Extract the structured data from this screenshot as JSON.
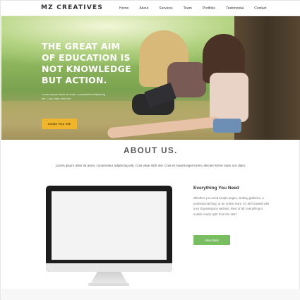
{
  "header": {
    "logo": "MZ CREATIVES",
    "nav": [
      "Home",
      "About",
      "Services",
      "Team",
      "Portfolio",
      "Testimonial",
      "Contact"
    ]
  },
  "hero": {
    "title": "THE GREAT AIM OF EDUCATION IS NOT KNOWLEDGE BUT ACTION.",
    "text": "Lorem ipsum dolor sit amet, consectetur adipiscing elit. Cras vitae nibh nisl.",
    "button": "Create Your Site"
  },
  "about": {
    "title": "ABOUT US.",
    "subtitle": "Lorem ipsum dolor sit amet, consectetur adipiscing elit. Cras vitae nibh nisl. Cras et mauris eget lorem ultricies ferme ntum a in diam."
  },
  "feature": {
    "title": "Everything You Need",
    "text": "Whether you need simple pages, striking galleries, a professional blog, or an online store, it's all included with your Squarespace website. Best of all, everything is mobile-ready right from the start.",
    "button": "View More"
  },
  "colors": {
    "accent_yellow": "#f0b52a",
    "accent_green": "#79bd63"
  }
}
